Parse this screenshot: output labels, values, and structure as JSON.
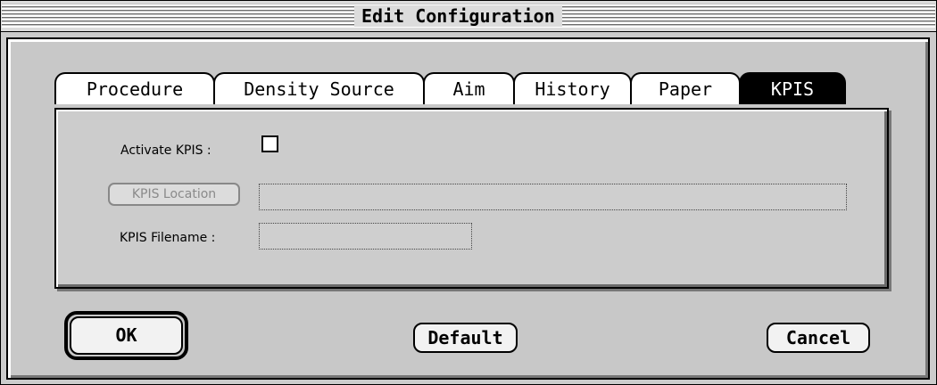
{
  "window": {
    "title": "Edit Configuration"
  },
  "tabs": [
    {
      "label": "Procedure",
      "selected": false
    },
    {
      "label": "Density Source",
      "selected": false
    },
    {
      "label": "Aim",
      "selected": false
    },
    {
      "label": "History",
      "selected": false
    },
    {
      "label": "Paper",
      "selected": false
    },
    {
      "label": "KPIS",
      "selected": true
    }
  ],
  "kpis_panel": {
    "activate_label": "Activate KPIS :",
    "activate_checked": false,
    "location_button_label": "KPIS Location",
    "location_value": "",
    "filename_label": "KPIS Filename :",
    "filename_value": ""
  },
  "buttons": {
    "ok_label": "OK",
    "default_label": "Default",
    "cancel_label": "Cancel"
  },
  "colors": {
    "window_bg": "#cccccc",
    "selected_tab_bg": "#000000",
    "disabled_text": "#8a8a8a"
  }
}
